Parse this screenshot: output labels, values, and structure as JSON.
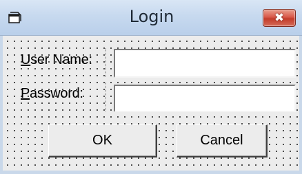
{
  "window": {
    "title": "Login",
    "close_glyph": "✖"
  },
  "form": {
    "username_label": "User Name:",
    "username_label_accel": "U",
    "username_label_rest": "ser Name:",
    "username_value": "",
    "password_label": "Password:",
    "password_label_accel": "P",
    "password_label_rest": "assword:",
    "password_value": ""
  },
  "buttons": {
    "ok_label": "OK",
    "cancel_label": "Cancel"
  },
  "colors": {
    "titlebar": "#c7d9ef",
    "close_button": "#d9584a",
    "form_background": "#ececec"
  },
  "icons": {
    "app": "window-icon",
    "close": "close-icon"
  }
}
